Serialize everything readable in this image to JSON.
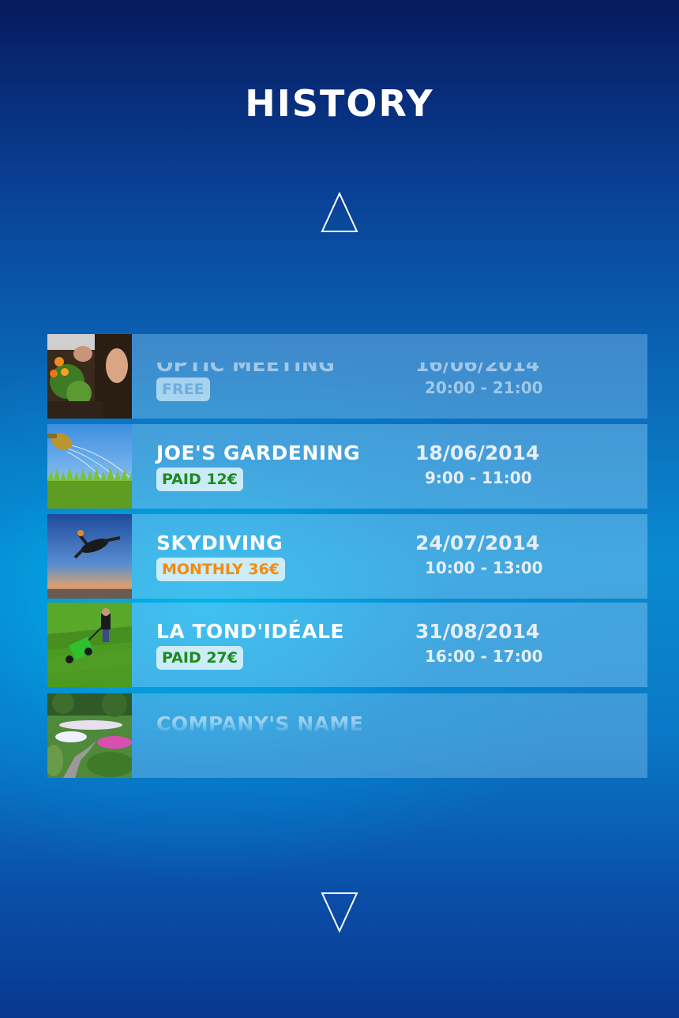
{
  "header": {
    "title": "HISTORY"
  },
  "nav": {
    "up_icon": "triangle-up-icon",
    "down_icon": "triangle-down-icon"
  },
  "colors": {
    "paid": "#1e8a1e",
    "monthly": "#f08c10",
    "free": "#7fb8e0"
  },
  "history": [
    {
      "name": "OPTIC MEETING",
      "badge": "FREE",
      "badge_type": "free",
      "date": "16/06/2014",
      "time": "20:00 - 21:00",
      "thumb": "flower-planting-image"
    },
    {
      "name": "JOE'S GARDENING",
      "badge": "PAID 12€",
      "badge_type": "paid",
      "date": "18/06/2014",
      "time": "9:00 - 11:00",
      "thumb": "watering-can-grass-image"
    },
    {
      "name": "SKYDIVING",
      "badge": "MONTHLY 36€",
      "badge_type": "monthly",
      "date": "24/07/2014",
      "time": "10:00 - 13:00",
      "thumb": "skydiver-image"
    },
    {
      "name": "LA TOND'IDÉALE",
      "badge": "PAID 27€",
      "badge_type": "paid",
      "date": "31/08/2014",
      "time": "16:00 - 17:00",
      "thumb": "lawn-mower-image"
    },
    {
      "name": "COMPANY'S NAME",
      "badge": "",
      "badge_type": "",
      "date": "",
      "time": "",
      "thumb": "garden-path-image"
    }
  ]
}
